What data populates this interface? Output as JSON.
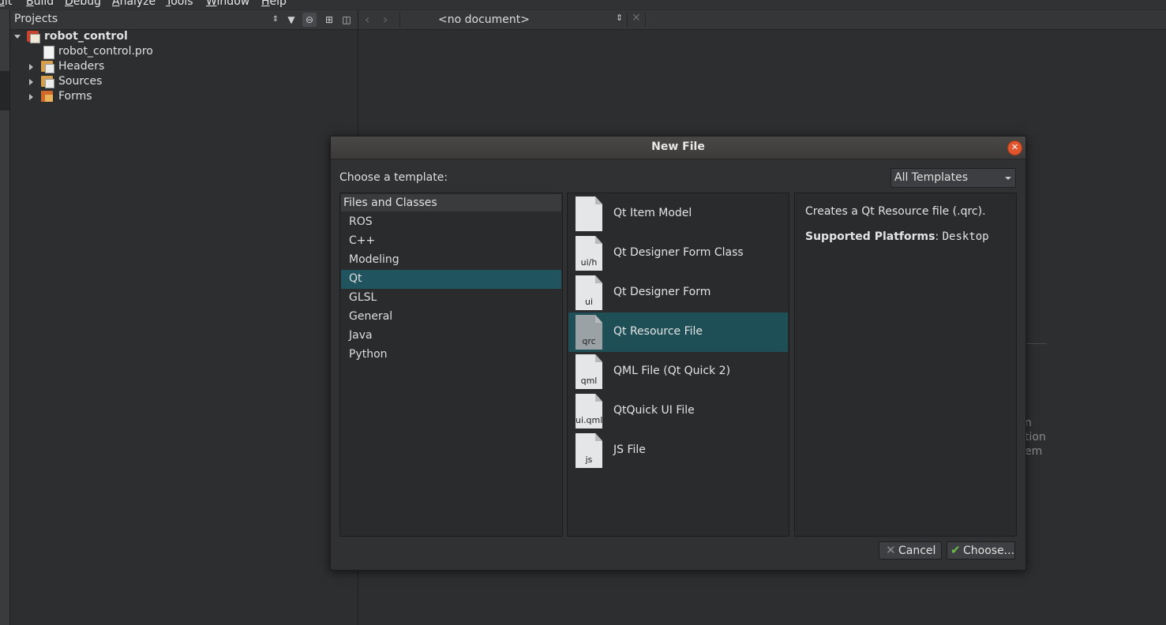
{
  "menubar": {
    "items": [
      "dit",
      "Build",
      "Debug",
      "Analyze",
      "Tools",
      "Window",
      "Help"
    ]
  },
  "projects_pane": {
    "title": "Projects",
    "tree": [
      {
        "label": "robot_control",
        "bold": true,
        "expanded": true
      },
      {
        "label": "robot_control.pro"
      },
      {
        "label": "Headers",
        "expanded": false
      },
      {
        "label": "Sources",
        "expanded": false
      },
      {
        "label": "Forms",
        "expanded": false
      }
    ]
  },
  "editor": {
    "document_label": "<no document>",
    "background_fragments": [
      "n",
      "tion",
      "em"
    ]
  },
  "dialog": {
    "title": "New File",
    "choose_label": "Choose a template:",
    "filter_combo": "All Templates",
    "categories_header": "Files and Classes",
    "categories": [
      "ROS",
      "C++",
      "Modeling",
      "Qt",
      "GLSL",
      "General",
      "Java",
      "Python"
    ],
    "selected_category": "Qt",
    "templates": [
      {
        "name": "Qt Item Model",
        "ext": ""
      },
      {
        "name": "Qt Designer Form Class",
        "ext": "ui/h"
      },
      {
        "name": "Qt Designer Form",
        "ext": "ui"
      },
      {
        "name": "Qt Resource File",
        "ext": "qrc"
      },
      {
        "name": "QML File (Qt Quick 2)",
        "ext": "qml"
      },
      {
        "name": "QtQuick UI File",
        "ext": "ui.qml"
      },
      {
        "name": "JS File",
        "ext": "js"
      }
    ],
    "selected_template": "Qt Resource File",
    "description": "Creates a Qt Resource file (.qrc).",
    "platforms_label": "Supported Platforms",
    "platforms_value": "Desktop",
    "cancel_label": "Cancel",
    "choose_button_label": "Choose...",
    "colors": {
      "selection": "#1e4f57",
      "close_button": "#e0562f"
    }
  }
}
